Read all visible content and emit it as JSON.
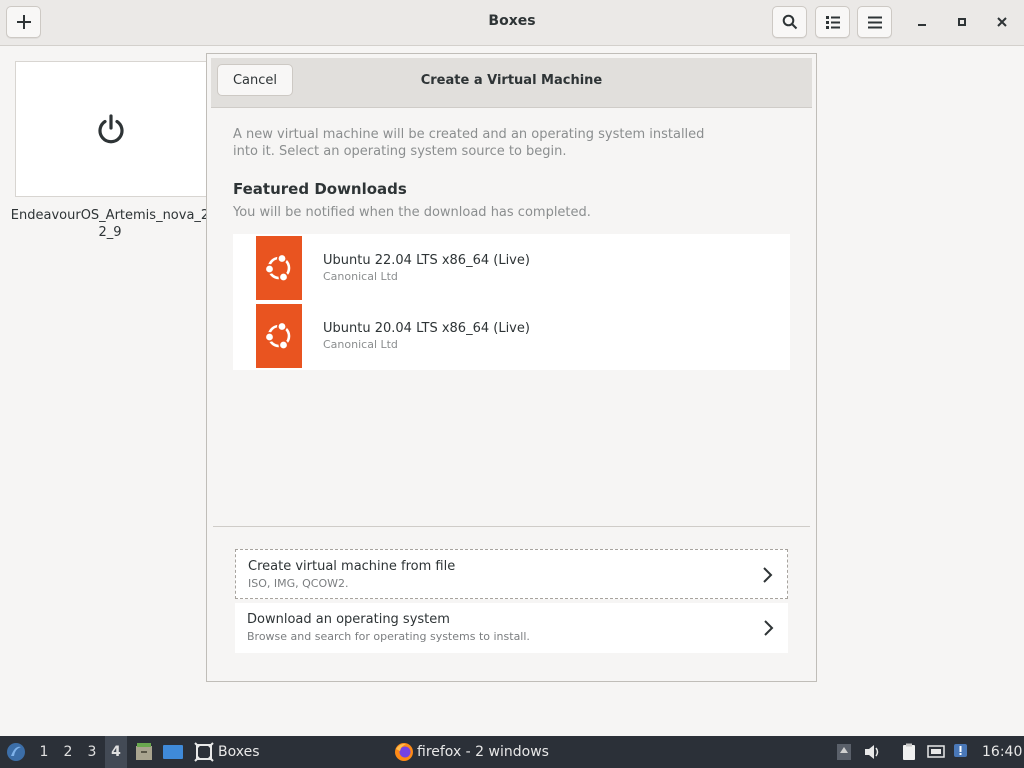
{
  "header": {
    "title": "Boxes",
    "new_button_icon": "plus-icon",
    "search_icon": "search-icon",
    "view_icon": "list-view-icon",
    "menu_icon": "hamburger-menu-icon",
    "minimize_label": "–",
    "maximize_label": "▫",
    "close_label": "✕"
  },
  "vm_tile": {
    "icon": "power-icon",
    "name": "EndeavourOS_Artemis_nova_22_9"
  },
  "dialog": {
    "cancel_label": "Cancel",
    "title": "Create a Virtual Machine",
    "intro": "A new virtual machine will be created and an operating system installed into it. Select an operating system source to begin.",
    "featured_title": "Featured Downloads",
    "featured_subtitle": "You will be notified when the download has completed.",
    "downloads": [
      {
        "name": "Ubuntu 22.04 LTS x86_64 (Live)",
        "vendor": "Canonical Ltd",
        "icon": "ubuntu-logo-icon"
      },
      {
        "name": "Ubuntu 20.04 LTS x86_64 (Live)",
        "vendor": "Canonical Ltd",
        "icon": "ubuntu-logo-icon"
      }
    ],
    "actions": [
      {
        "title": "Create virtual machine from file",
        "subtitle": "ISO, IMG, QCOW2."
      },
      {
        "title": "Download an operating system",
        "subtitle": "Browse and search for operating systems to install."
      }
    ],
    "brand_color": "#e95420"
  },
  "taskbar": {
    "workspaces": [
      "1",
      "2",
      "3",
      "4"
    ],
    "active_workspace": "4",
    "boxes_label": "Boxes",
    "firefox_label": "firefox - 2 windows",
    "clock": "16:40"
  }
}
